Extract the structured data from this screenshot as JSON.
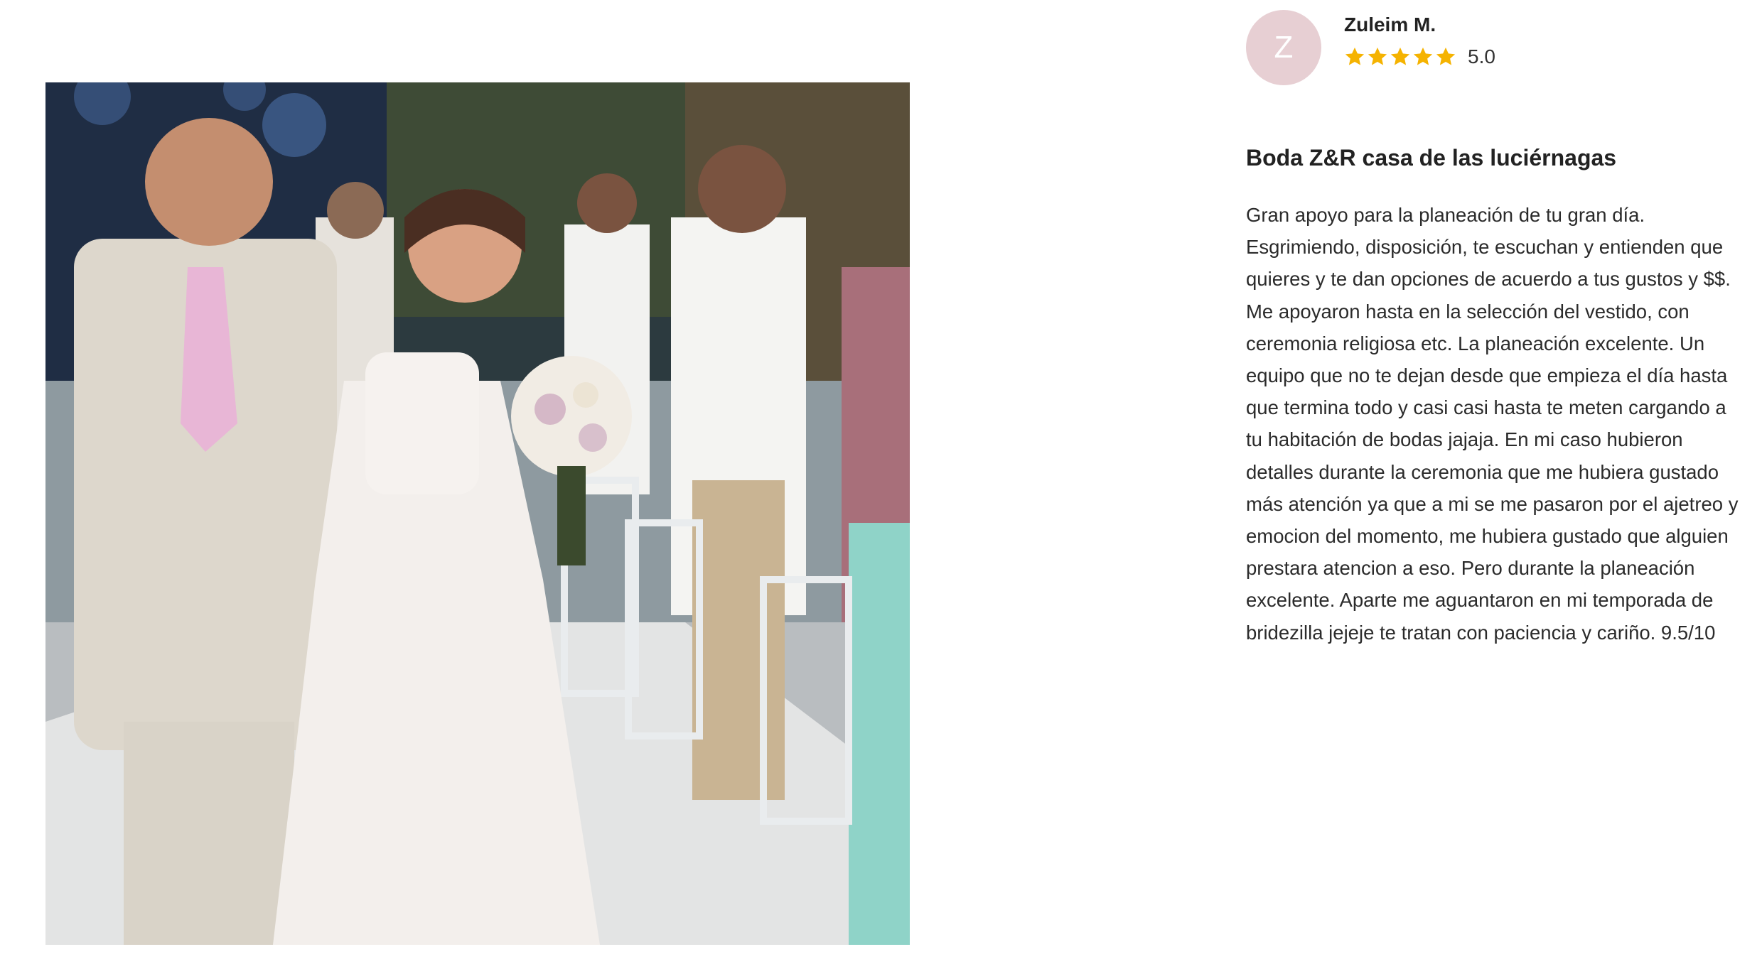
{
  "review": {
    "avatar_initial": "Z",
    "author_name": "Zuleim M.",
    "rating_value": "5.0",
    "rating": 5,
    "star_color": "#f5b301",
    "avatar_color": "#e7cfd3",
    "title": "Boda Z&R casa de las luciérnagas",
    "body": "Gran apoyo para la planeación de tu gran día. Esgrimiendo, disposición, te escuchan y entienden que quieres y te dan opciones de acuerdo a tus gustos y $$. Me apoyaron hasta en la selección del vestido, con ceremonia religiosa etc. La planeación excelente. Un equipo que no te dejan desde que empieza el día hasta que termina todo y casi casi hasta te meten cargando a tu habitación de bodas jajaja. En mi caso hubieron detalles durante la ceremonia que me hubiera gustado más atención ya que a mi se me pasaron por el ajetreo y emocion del momento, me hubiera gustado que alguien prestara atencion a eso. Pero durante la planeación excelente. Aparte me aguantaron en mi temporada de bridezilla jejeje te tratan con paciencia y cariño. 9.5/10"
  },
  "photo": {
    "icon": "wedding-photo"
  }
}
